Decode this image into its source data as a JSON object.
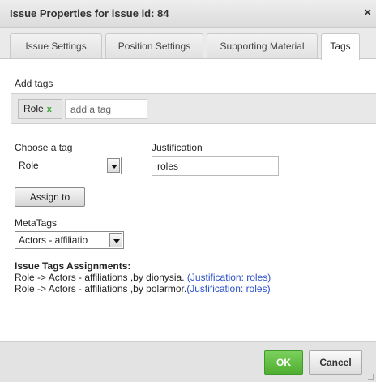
{
  "dialog": {
    "title": "Issue Properties for issue id: 84",
    "close_glyph": "×"
  },
  "tabs": [
    {
      "label": "Issue Settings"
    },
    {
      "label": "Position Settings"
    },
    {
      "label": "Supporting Material"
    },
    {
      "label": "Tags",
      "active": true
    }
  ],
  "add_tags": {
    "label": "Add tags",
    "chip_label": "Role",
    "chip_remove": "x",
    "input_placeholder": "add a tag"
  },
  "choose_tag": {
    "label": "Choose a tag",
    "selected": "Role"
  },
  "justification": {
    "label": "Justification",
    "value": "roles"
  },
  "assign_button": "Assign to",
  "metatags": {
    "label": "MetaTags",
    "selected": "Actors - affiliatio"
  },
  "assignments": {
    "heading": "Issue Tags Assignments:",
    "rows": [
      {
        "text": "Role -> Actors - affiliations ,by dionysia. ",
        "justification": "(Justification: roles)"
      },
      {
        "text": "Role -> Actors - affiliations ,by polarmor.",
        "justification": "(Justification: roles)"
      }
    ]
  },
  "footer": {
    "ok_label": "OK",
    "cancel_label": "Cancel"
  },
  "colors": {
    "ok_green": "#5cb83d",
    "link_blue": "#2a4fc9",
    "chip_x_green": "#3aa83a"
  }
}
